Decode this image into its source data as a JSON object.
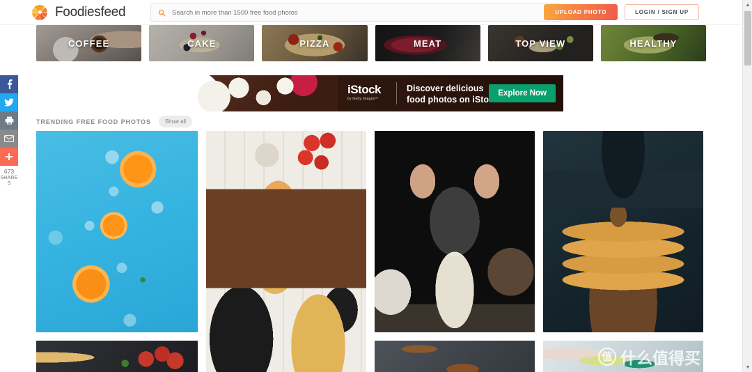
{
  "header": {
    "brand_name": "Foodiesfeed",
    "logo_icon": "aperture-pinwheel-icon",
    "search": {
      "icon": "search-icon",
      "placeholder": "Search in more than 1500 free food photos",
      "value": ""
    },
    "upload_label": "UPLOAD PHOTO",
    "login_label": "LOGIN / SIGN UP",
    "accent_gradient_start": "#f9a73e",
    "accent_gradient_end": "#ef5b4c"
  },
  "categories": [
    {
      "label": "COFFEE",
      "art": "art-coffee"
    },
    {
      "label": "CAKE",
      "art": "art-cake"
    },
    {
      "label": "PIZZA",
      "art": "art-pizza"
    },
    {
      "label": "MEAT",
      "art": "art-meat"
    },
    {
      "label": "TOP VIEW",
      "art": "art-topview"
    },
    {
      "label": "HEALTHY",
      "art": "art-healthy"
    }
  ],
  "ad": {
    "logo": "iStock",
    "logo_sub": "by Getty Images™",
    "headline_line1": "Discover delicious",
    "headline_line2": "food photos on iStock",
    "cta_label": "Explore Now",
    "cta_color": "#0aa06e"
  },
  "section": {
    "title": "TRENDING FREE FOOD PHOTOS",
    "show_all_label": "Show all"
  },
  "photos": {
    "col1": [
      {
        "name": "orange-slices-on-blue-background",
        "class": "ph-orange"
      },
      {
        "name": "pizza-with-cherry-tomatoes-on-slate",
        "class": "ph-pizza"
      }
    ],
    "col2": [
      {
        "name": "burger-flat-lay-on-white-wood",
        "class": "ph-burger"
      }
    ],
    "col3": [
      {
        "name": "hands-sifting-flour-dark-kitchen",
        "class": "ph-flour"
      },
      {
        "name": "cinnamon-spices-on-grey-stone",
        "class": "ph-spice"
      }
    ],
    "col4": [
      {
        "name": "pancake-stack-with-syrup",
        "class": "ph-pancake"
      },
      {
        "name": "green-drink-bottle-closeup",
        "class": "ph-drink"
      }
    ]
  },
  "watermark": {
    "badge": "值",
    "text": "什么值得买"
  },
  "share_rail": {
    "items": [
      {
        "name": "facebook-share",
        "glyph": "f",
        "class": "s-fb",
        "color": "#3b5998"
      },
      {
        "name": "twitter-share",
        "glyph": "🐦",
        "class": "s-tw",
        "color": "#22a7f0"
      },
      {
        "name": "print-page",
        "glyph": "⎙",
        "class": "s-pr",
        "color": "#6d7b84"
      },
      {
        "name": "email-share",
        "glyph": "✉",
        "class": "s-em",
        "color": "#8a8a8a"
      },
      {
        "name": "more-share-options",
        "glyph": "+",
        "class": "s-pl",
        "color": "#fb6a55"
      }
    ],
    "count": "673",
    "count_label_line1": "SHARE",
    "count_label_line2": "S"
  },
  "scrollbar": {
    "up_glyph": "▲",
    "down_glyph": "▼"
  }
}
